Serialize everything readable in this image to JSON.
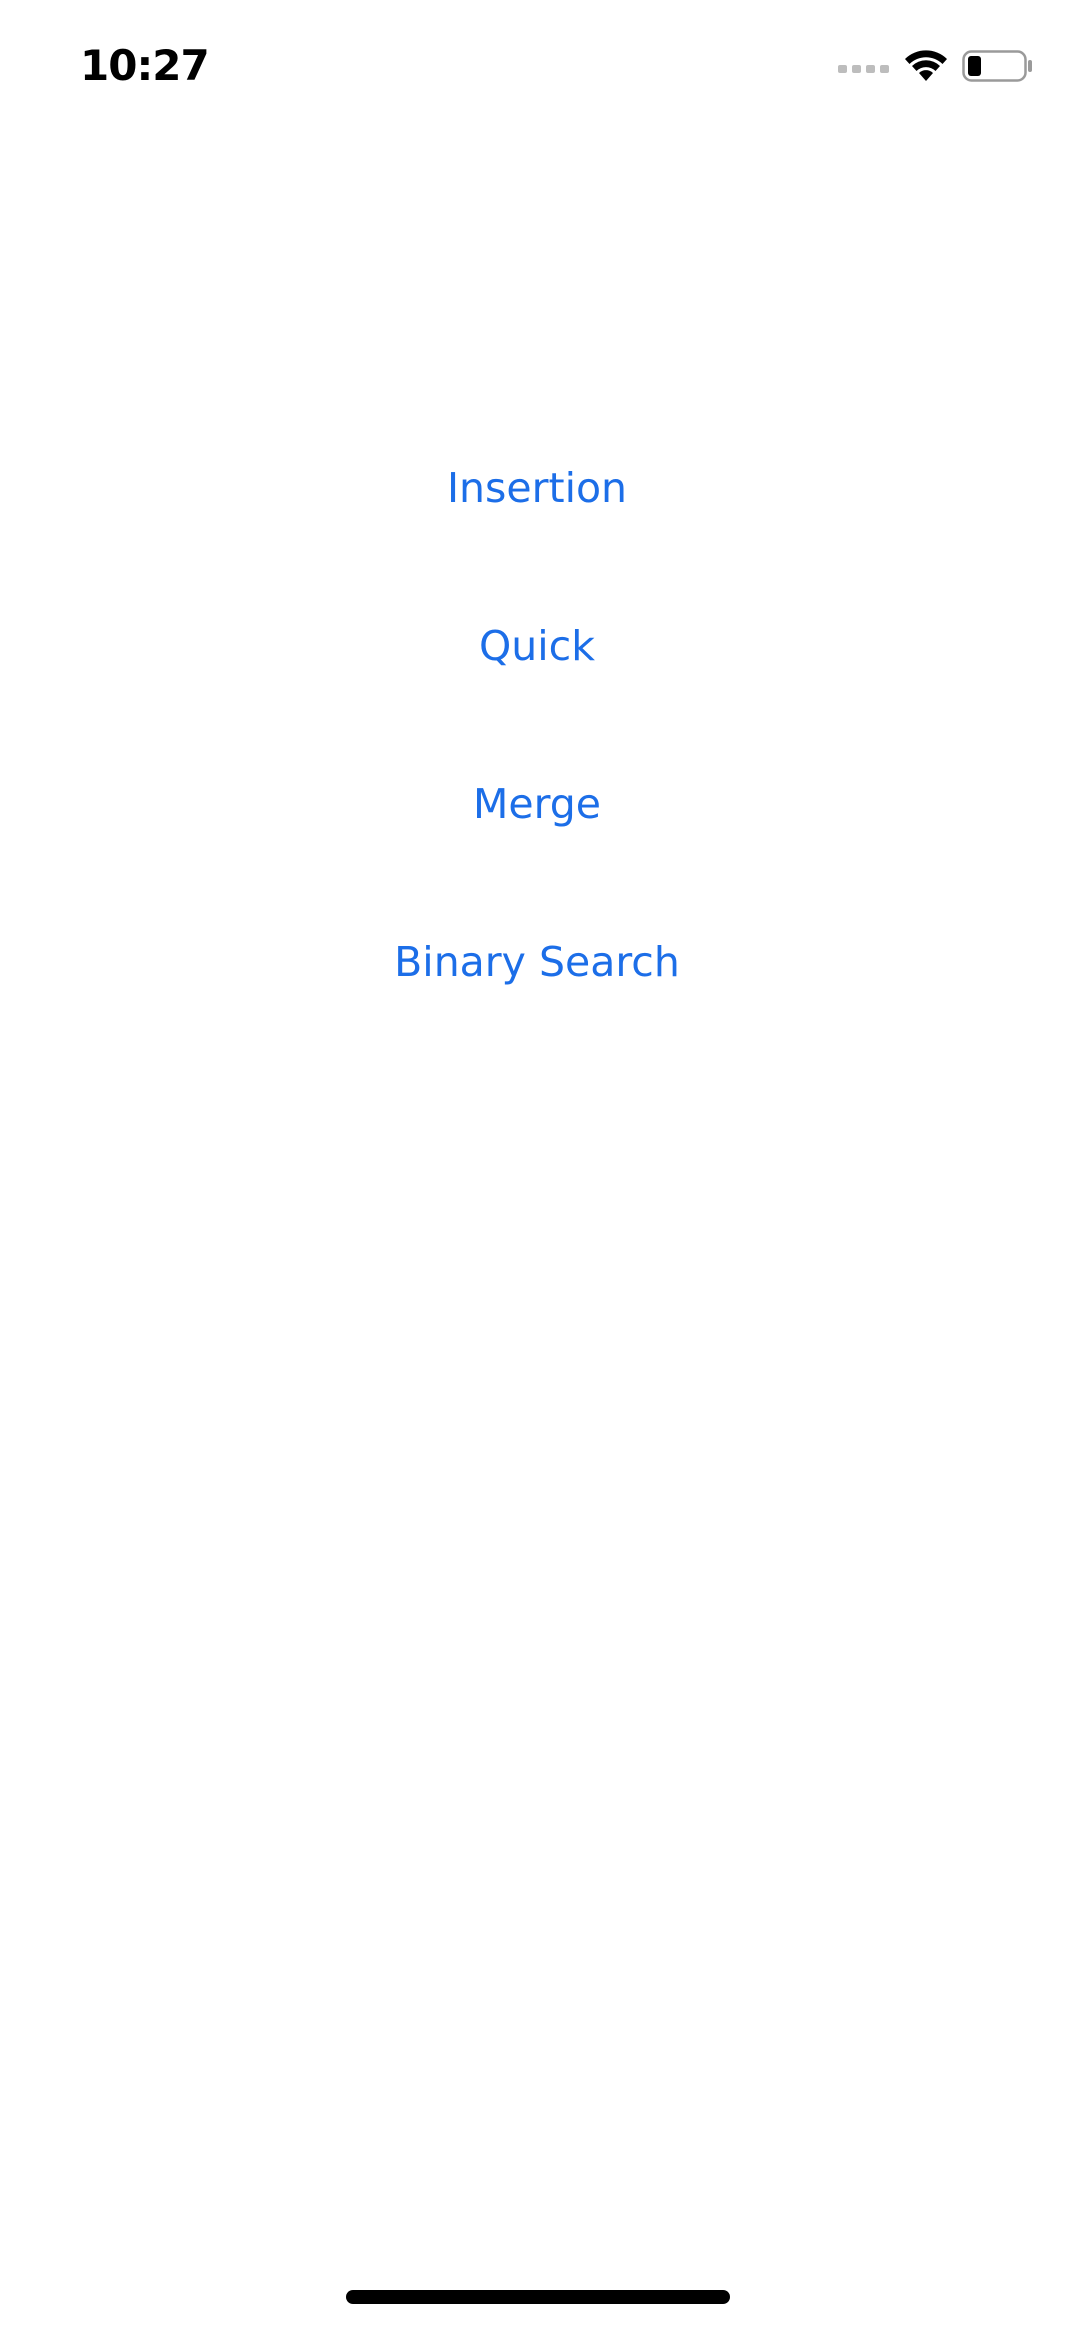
{
  "status_bar": {
    "time": "10:27",
    "signal_icon": "cellular-signal-icon",
    "wifi_icon": "wifi-icon",
    "battery_icon": "battery-icon",
    "battery_level": 0.25
  },
  "menu": {
    "accent_color": "#1c6ee8",
    "items": [
      {
        "label": "Insertion"
      },
      {
        "label": "Quick"
      },
      {
        "label": "Merge"
      },
      {
        "label": "Binary Search"
      }
    ]
  }
}
